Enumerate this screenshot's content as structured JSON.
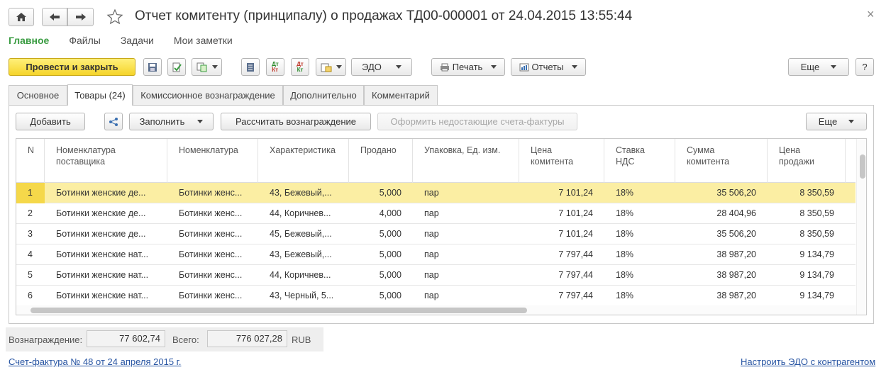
{
  "title": "Отчет комитенту (принципалу) о продажах ТД00-000001 от 24.04.2015 13:55:44",
  "icons": {
    "home": "home-icon",
    "back": "arrow-left-icon",
    "forward": "arrow-right-icon",
    "favorite": "star-icon",
    "close": "close-icon"
  },
  "close_glyph": "×",
  "menu": [
    "Главное",
    "Файлы",
    "Задачи",
    "Мои заметки"
  ],
  "toolbar": {
    "post_close": "Провести и закрыть",
    "edo": "ЭДО",
    "print": "Печать",
    "reports": "Отчеты",
    "more": "Еще",
    "help": "?",
    "dt_kt_top": "Дт",
    "dt_kt_bottom": "Кт"
  },
  "tabs": [
    "Основное",
    "Товары (24)",
    "Комиссионное вознаграждение",
    "Дополнительно",
    "Комментарий"
  ],
  "table_toolbar": {
    "add": "Добавить",
    "fill": "Заполнить",
    "calc": "Рассчитать вознаграждение",
    "invoices": "Оформить недостающие счета-фактуры",
    "more": "Еще"
  },
  "columns": [
    {
      "line1": "N",
      "line2": ""
    },
    {
      "line1": "Номенклатура",
      "line2": "поставщика"
    },
    {
      "line1": "Номенклатура",
      "line2": ""
    },
    {
      "line1": "Характеристика",
      "line2": ""
    },
    {
      "line1": "Продано",
      "line2": ""
    },
    {
      "line1": "Упаковка, Ед. изм.",
      "line2": ""
    },
    {
      "line1": "Цена",
      "line2": "комитента"
    },
    {
      "line1": "Ставка",
      "line2": "НДС"
    },
    {
      "line1": "Сумма",
      "line2": "комитента"
    },
    {
      "line1": "Цена",
      "line2": "продажи"
    }
  ],
  "rows": [
    [
      "1",
      "Ботинки женские де...",
      "Ботинки женс...",
      "43, Бежевый,...",
      "5,000",
      "пар",
      "7 101,24",
      "18%",
      "35 506,20",
      "8 350,59"
    ],
    [
      "2",
      "Ботинки женские де...",
      "Ботинки женс...",
      "44, Коричнев...",
      "4,000",
      "пар",
      "7 101,24",
      "18%",
      "28 404,96",
      "8 350,59"
    ],
    [
      "3",
      "Ботинки женские де...",
      "Ботинки женс...",
      "45, Бежевый,...",
      "5,000",
      "пар",
      "7 101,24",
      "18%",
      "35 506,20",
      "8 350,59"
    ],
    [
      "4",
      "Ботинки женские нат...",
      "Ботинки женс...",
      "43, Бежевый,...",
      "5,000",
      "пар",
      "7 797,44",
      "18%",
      "38 987,20",
      "9 134,79"
    ],
    [
      "5",
      "Ботинки женские нат...",
      "Ботинки женс...",
      "44, Коричнев...",
      "5,000",
      "пар",
      "7 797,44",
      "18%",
      "38 987,20",
      "9 134,79"
    ],
    [
      "6",
      "Ботинки женские нат...",
      "Ботинки женс...",
      "43, Черный, 5...",
      "5,000",
      "пар",
      "7 797,44",
      "18%",
      "38 987,20",
      "9 134,79"
    ]
  ],
  "totals": {
    "reward_label": "Вознаграждение:",
    "reward_value": "77 602,74",
    "total_label": "Всего:",
    "total_value": "776 027,28",
    "currency": "RUB"
  },
  "links": {
    "invoice": "Счет-фактура № 48 от 24 апреля 2015 г.",
    "edo_setup": "Настроить ЭДО с контрагентом"
  },
  "colors": {
    "accent_green": "#3a9c42",
    "primary_button": "#f5d42a",
    "selected_row": "#fbeea3",
    "link": "#2855a3"
  }
}
